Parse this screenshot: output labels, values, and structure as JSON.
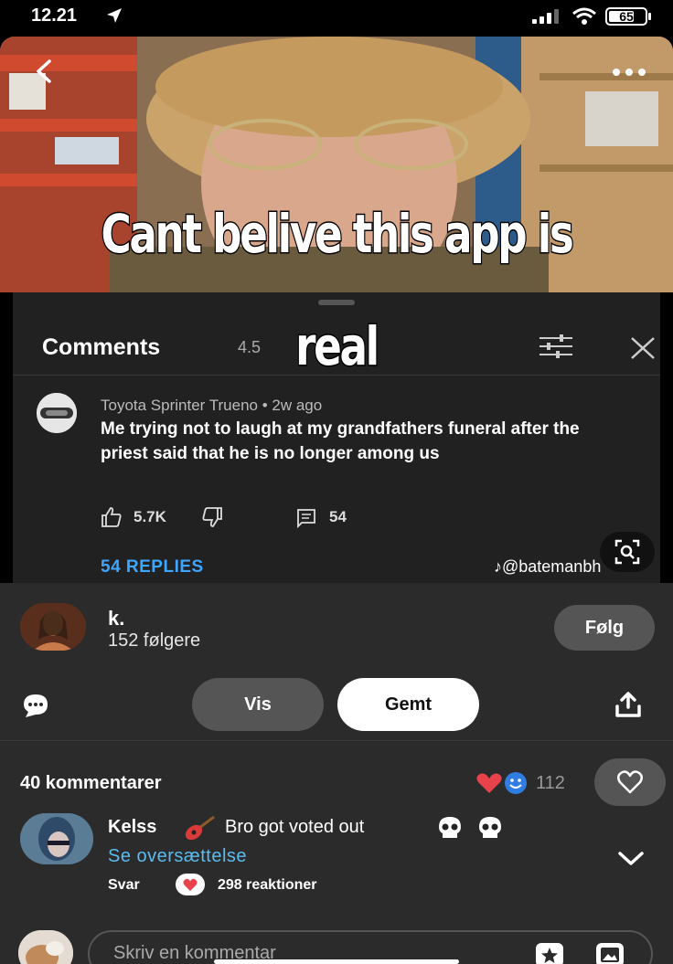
{
  "status_bar": {
    "time": "12.21",
    "battery": "65"
  },
  "meme": {
    "caption_line1": "Cant belive this app is",
    "caption_line2": "real"
  },
  "youtube_comments": {
    "title": "Comments",
    "count": "4.5",
    "comment": {
      "author": "Toyota Sprinter Trueno • 2w ago",
      "text": "Me trying not to laugh at my grandfathers funeral after the priest said that he is no longer among us",
      "likes": "5.7K",
      "replies_count": "54",
      "replies_link": "54 REPLIES"
    },
    "watermark": "@batemanbh"
  },
  "pin": {
    "user_name": "k.",
    "followers": "152 følgere",
    "follow_label": "Følg",
    "vis_label": "Vis",
    "gemt_label": "Gemt"
  },
  "comments": {
    "header": "40 kommentarer",
    "reaction_count": "112",
    "item": {
      "author": "Kelss",
      "text": "Bro got voted out",
      "translate": "Se oversættelse",
      "reply": "Svar",
      "reactions": "298 reaktioner"
    },
    "input_placeholder": "Skriv en kommentar"
  },
  "icons": {
    "back": "chevron-left-icon",
    "more": "more-icon",
    "filter": "filter-icon",
    "close": "close-icon",
    "like": "thumbs-up-icon",
    "dislike": "thumbs-down-icon",
    "reply": "reply-icon",
    "lens": "lens-icon",
    "chat": "chat-icon",
    "share": "share-icon",
    "heart": "heart-icon",
    "chevron_down": "chevron-down-icon",
    "sticker": "sticker-icon",
    "image": "image-icon"
  },
  "colors": {
    "link_blue": "#3ea6ff",
    "translate_blue": "#5bbcf0",
    "panel_dark": "#212121",
    "pin_bg": "#2b2b2b"
  }
}
